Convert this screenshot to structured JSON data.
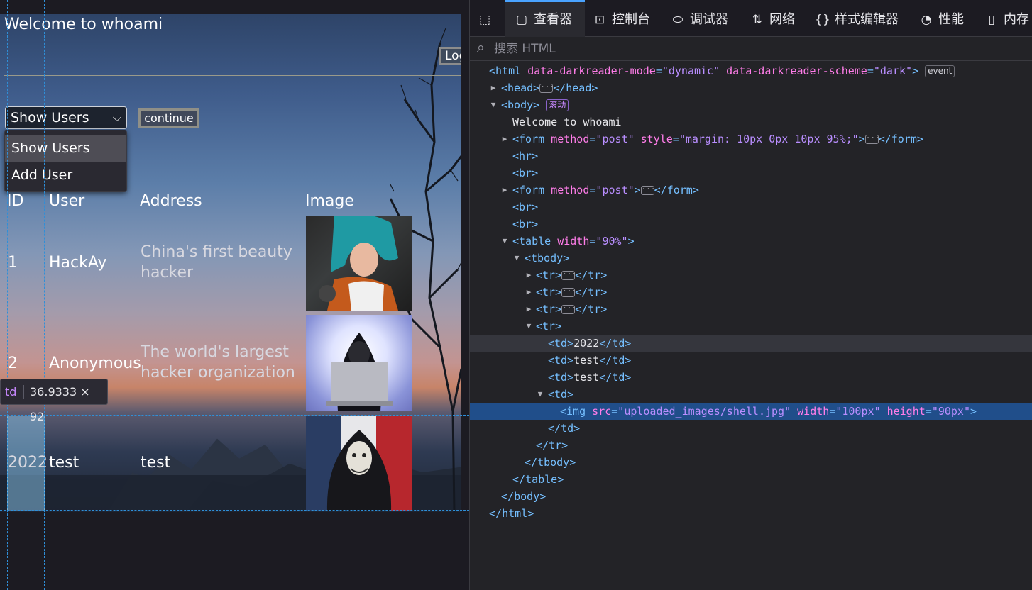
{
  "page": {
    "welcome": "Welcome to whoami",
    "logout_label": "Logout",
    "select": {
      "value": "Show Users",
      "options": [
        "Show Users",
        "Add User"
      ]
    },
    "continue_label": "continue",
    "table": {
      "headers": [
        "ID",
        "User",
        "Address",
        "Image"
      ],
      "rows": [
        {
          "id": "1",
          "user": "HackAy",
          "address_1": "China's first beauty",
          "address_2": "hacker"
        },
        {
          "id": "2",
          "user": "Anonymous",
          "address_1": "The world's largest",
          "address_2": "hacker organization"
        },
        {
          "id": "2022",
          "user": "test",
          "address_1": "test",
          "address_2": ""
        }
      ]
    },
    "size_tip": {
      "tag": "td",
      "dims": "36.9333 × 92"
    }
  },
  "devtools": {
    "tabs": [
      {
        "label": "",
        "icon": "pick-element-icon"
      },
      {
        "label": "查看器",
        "icon": "inspector-icon"
      },
      {
        "label": "控制台",
        "icon": "console-icon"
      },
      {
        "label": "调试器",
        "icon": "debugger-icon"
      },
      {
        "label": "网络",
        "icon": "network-icon"
      },
      {
        "label": "样式编辑器",
        "icon": "style-editor-icon"
      },
      {
        "label": "性能",
        "icon": "performance-icon"
      },
      {
        "label": "内存",
        "icon": "memory-icon"
      }
    ],
    "search_placeholder": "搜索 HTML",
    "tree": {
      "html_tag": "html",
      "html_attr1": "data-darkreader-mode",
      "html_val1": "dynamic",
      "html_attr2": "data-darkreader-scheme",
      "html_val2": "dark",
      "event_badge": "event",
      "head_tag": "head",
      "body_tag": "body",
      "scroll_badge": "滚动",
      "welcome_text": "Welcome to whoami",
      "form_tag": "form",
      "method_attr": "method",
      "post_val": "post",
      "style_attr": "style",
      "style_val": "margin: 10px 0px 10px 95%;",
      "hr_tag": "hr",
      "br_tag": "br",
      "table_tag": "table",
      "width_attr": "width",
      "table_width_val": "90%",
      "tbody_tag": "tbody",
      "tr_tag": "tr",
      "td_tag": "td",
      "td_text_1": "2022",
      "td_text_2": "test",
      "td_text_3": "test",
      "img_tag": "img",
      "src_attr": "src",
      "img_src": "uploaded_images/shell.jpg",
      "img_width_val": "100px",
      "height_attr": "height",
      "img_height_val": "90px"
    }
  },
  "colors": {
    "accent": "#4aa3ff",
    "selected_row": "#204e8a",
    "tag": "#75bfff",
    "attribute": "#ff7de9",
    "value": "#b98eff"
  }
}
